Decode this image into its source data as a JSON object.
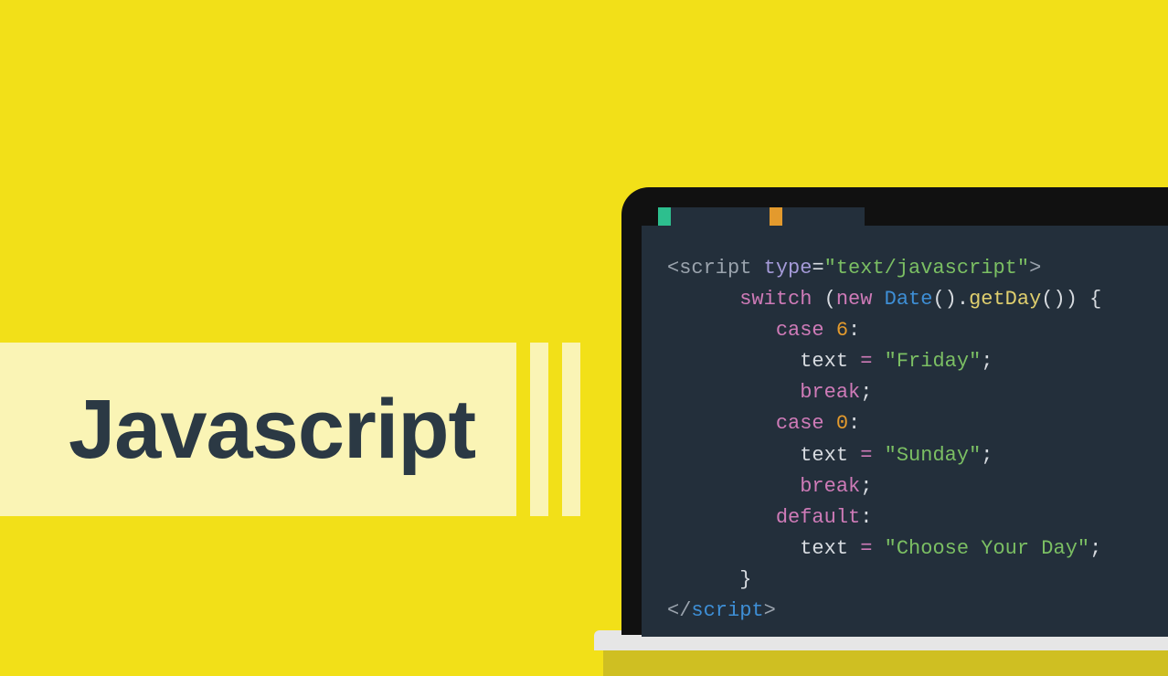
{
  "title": "Javascript",
  "code": {
    "l1": {
      "a": "<script",
      "b": " type",
      "c": "=",
      "d": "\"text/javascript\"",
      "e": ">"
    },
    "l2": {
      "a": "switch",
      "b": " (",
      "c": "new",
      "d": " Date",
      "e": "().",
      "f": "getDay",
      "g": "()) {"
    },
    "l3": {
      "a": "case",
      "b": " 6",
      "c": ":"
    },
    "l4": {
      "a": "text ",
      "b": "=",
      "c": " \"Friday\"",
      "d": ";"
    },
    "l5": {
      "a": "break",
      "b": ";"
    },
    "l6": {
      "a": "case",
      "b": " 0",
      "c": ":"
    },
    "l7": {
      "a": "text ",
      "b": "=",
      "c": " \"Sunday\"",
      "d": ";"
    },
    "l8": {
      "a": "break",
      "b": ";"
    },
    "l9": {
      "a": "default",
      "b": ":"
    },
    "l10": {
      "a": "text ",
      "b": "=",
      "c": " \"Choose Your Day\"",
      "d": ";"
    },
    "l11": {
      "a": "}"
    },
    "l12": {
      "a": "</",
      "b": "script",
      "c": ">"
    }
  }
}
